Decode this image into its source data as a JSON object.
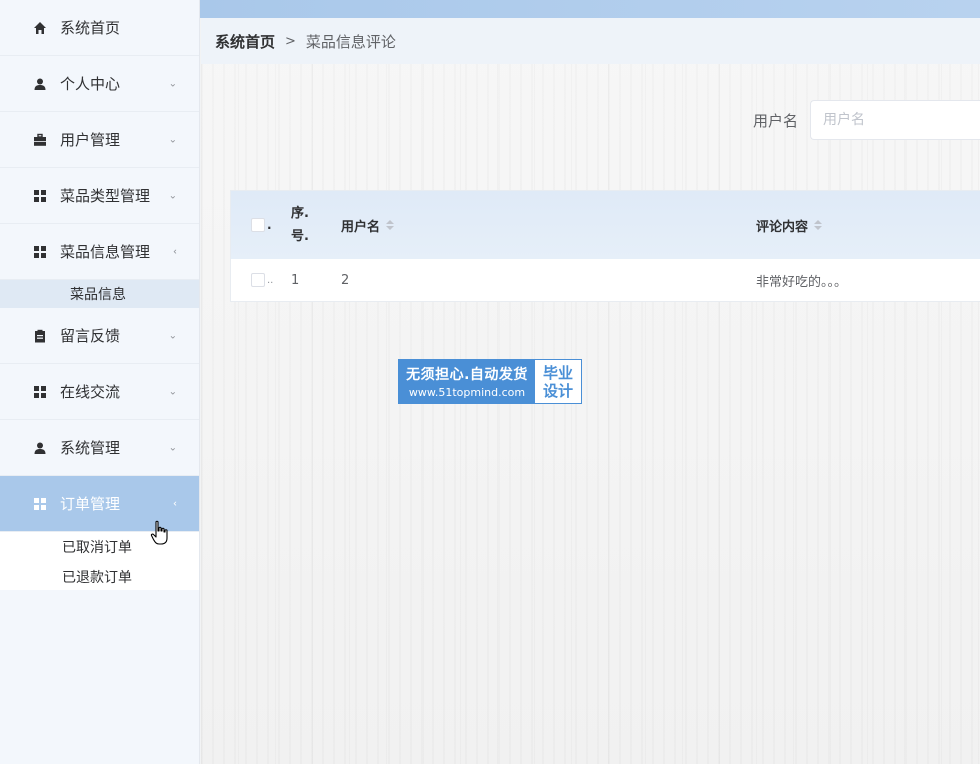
{
  "sidebar": {
    "items": [
      {
        "label": "系统首页",
        "icon": "home-icon",
        "arrow": ""
      },
      {
        "label": "个人中心",
        "icon": "user-icon",
        "arrow": "⌄"
      },
      {
        "label": "用户管理",
        "icon": "briefcase-icon",
        "arrow": "⌄"
      },
      {
        "label": "菜品类型管理",
        "icon": "grid-icon",
        "arrow": "⌄"
      },
      {
        "label": "菜品信息管理",
        "icon": "grid-icon",
        "arrow": "‹"
      },
      {
        "label": "留言反馈",
        "icon": "clipboard-icon",
        "arrow": "⌄"
      },
      {
        "label": "在线交流",
        "icon": "grid-icon",
        "arrow": "⌄"
      },
      {
        "label": "系统管理",
        "icon": "user-icon",
        "arrow": "⌄"
      },
      {
        "label": "订单管理",
        "icon": "grid-icon",
        "arrow": "‹"
      }
    ],
    "submenu_dish": "菜品信息",
    "submenu_orders": [
      "已取消订单",
      "已退款订单"
    ]
  },
  "breadcrumb": {
    "home": "系统首页",
    "separator": ">",
    "current": "菜品信息评论"
  },
  "search": {
    "label": "用户名",
    "placeholder": "用户名",
    "value": ""
  },
  "table": {
    "headers": {
      "checkbox_mark": ".",
      "seq": "序号",
      "seq_line1": "序.",
      "seq_line2": "号.",
      "username": "用户名",
      "comment": "评论内容"
    },
    "rows": [
      {
        "checkbox_mark": "..",
        "seq": "1",
        "username": "2",
        "comment": "非常好吃的。。。"
      }
    ]
  },
  "watermark": {
    "line1": "无须担心.自动发货",
    "line2": "www.51topmind.com",
    "right1": "毕业",
    "right2": "设计"
  },
  "colors": {
    "accent": "#a9c8ea",
    "header_bg": "#dfeaf7",
    "watermark_blue": "#4a8fd6"
  }
}
